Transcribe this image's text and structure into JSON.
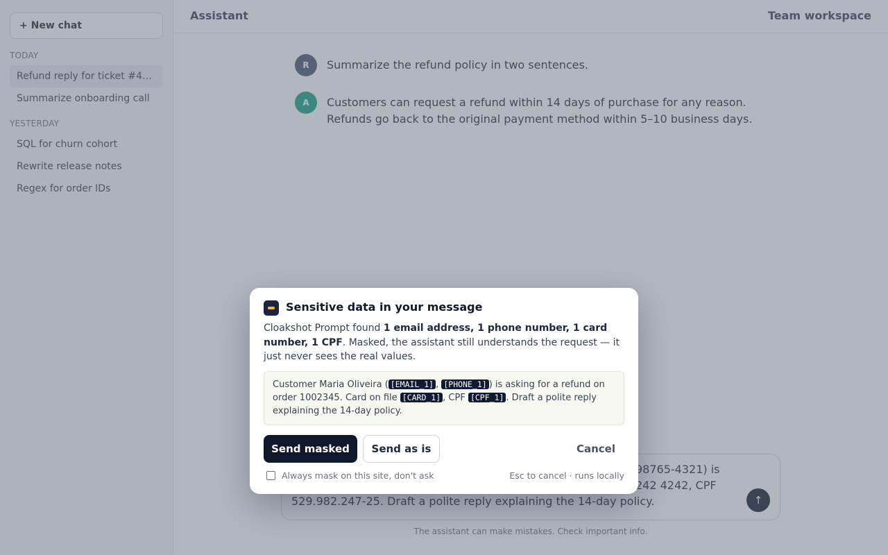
{
  "sidebar": {
    "new_chat_label": "+ New chat",
    "today_label": "TODAY",
    "yesterday_label": "YESTERDAY",
    "today_items": [
      "Refund reply for ticket #4…",
      "Summarize onboarding call"
    ],
    "yesterday_items": [
      "SQL for churn cohort",
      "Rewrite release notes",
      "Regex for order IDs"
    ]
  },
  "header": {
    "title": "Assistant",
    "workspace": "Team workspace"
  },
  "messages": [
    {
      "role_initial": "R",
      "lines": [
        "Summarize the refund policy in two sentences."
      ]
    },
    {
      "role_initial": "A",
      "lines": [
        "Customers can request a refund within 14 days of purchase for any reason.",
        "Refunds go back to the original payment method within 5–10 business days."
      ]
    }
  ],
  "composer": {
    "line1": "98765-4321) is",
    "line2": "242 4242, CPF",
    "line3": "529.982.247-25. Draft a polite reply explaining the 14-day policy.",
    "send_icon": "↑",
    "disclaimer": "The assistant can make mistakes. Check important info."
  },
  "modal": {
    "title": "Sensitive data in your message",
    "body_prefix": "Cloakshot Prompt found ",
    "body_bold": "1 email address, 1 phone number, 1 card number, 1 CPF",
    "body_suffix": ". Masked, the assistant still understands the request — it just never sees the real values.",
    "preview": {
      "p1": "Customer Maria Oliveira (",
      "t1": "[EMAIL_1]",
      "p2": ", ",
      "t2": "[PHONE_1]",
      "p3": ") is asking for a refund on order 1002345. Card on file ",
      "t3": "[CARD_1]",
      "p4": ", CPF ",
      "t4": "[CPF_1]",
      "p5": ". Draft a polite reply explaining the 14-day policy."
    },
    "send_masked": "Send masked",
    "send_as_is": "Send as is",
    "cancel": "Cancel",
    "always_mask_label": "Always mask on this site, don't ask",
    "footnote": "Esc to cancel · runs locally"
  }
}
